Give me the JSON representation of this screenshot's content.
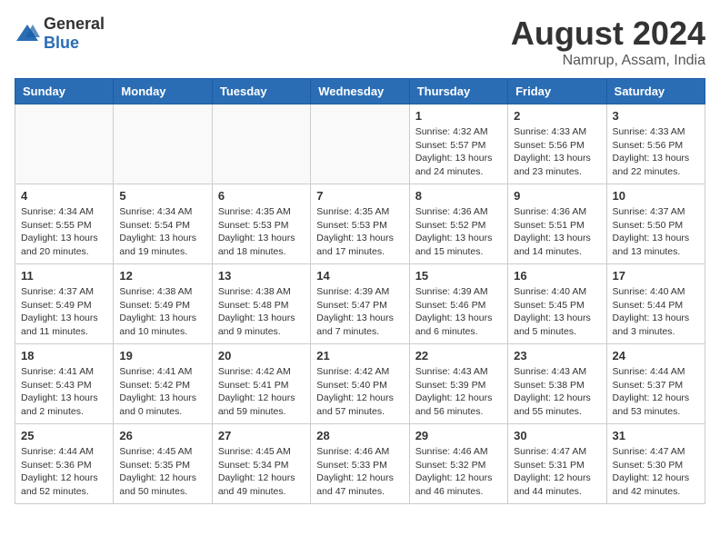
{
  "header": {
    "logo_general": "General",
    "logo_blue": "Blue",
    "month_year": "August 2024",
    "location": "Namrup, Assam, India"
  },
  "days_of_week": [
    "Sunday",
    "Monday",
    "Tuesday",
    "Wednesday",
    "Thursday",
    "Friday",
    "Saturday"
  ],
  "weeks": [
    [
      {
        "day": "",
        "info": ""
      },
      {
        "day": "",
        "info": ""
      },
      {
        "day": "",
        "info": ""
      },
      {
        "day": "",
        "info": ""
      },
      {
        "day": "1",
        "info": "Sunrise: 4:32 AM\nSunset: 5:57 PM\nDaylight: 13 hours\nand 24 minutes."
      },
      {
        "day": "2",
        "info": "Sunrise: 4:33 AM\nSunset: 5:56 PM\nDaylight: 13 hours\nand 23 minutes."
      },
      {
        "day": "3",
        "info": "Sunrise: 4:33 AM\nSunset: 5:56 PM\nDaylight: 13 hours\nand 22 minutes."
      }
    ],
    [
      {
        "day": "4",
        "info": "Sunrise: 4:34 AM\nSunset: 5:55 PM\nDaylight: 13 hours\nand 20 minutes."
      },
      {
        "day": "5",
        "info": "Sunrise: 4:34 AM\nSunset: 5:54 PM\nDaylight: 13 hours\nand 19 minutes."
      },
      {
        "day": "6",
        "info": "Sunrise: 4:35 AM\nSunset: 5:53 PM\nDaylight: 13 hours\nand 18 minutes."
      },
      {
        "day": "7",
        "info": "Sunrise: 4:35 AM\nSunset: 5:53 PM\nDaylight: 13 hours\nand 17 minutes."
      },
      {
        "day": "8",
        "info": "Sunrise: 4:36 AM\nSunset: 5:52 PM\nDaylight: 13 hours\nand 15 minutes."
      },
      {
        "day": "9",
        "info": "Sunrise: 4:36 AM\nSunset: 5:51 PM\nDaylight: 13 hours\nand 14 minutes."
      },
      {
        "day": "10",
        "info": "Sunrise: 4:37 AM\nSunset: 5:50 PM\nDaylight: 13 hours\nand 13 minutes."
      }
    ],
    [
      {
        "day": "11",
        "info": "Sunrise: 4:37 AM\nSunset: 5:49 PM\nDaylight: 13 hours\nand 11 minutes."
      },
      {
        "day": "12",
        "info": "Sunrise: 4:38 AM\nSunset: 5:49 PM\nDaylight: 13 hours\nand 10 minutes."
      },
      {
        "day": "13",
        "info": "Sunrise: 4:38 AM\nSunset: 5:48 PM\nDaylight: 13 hours\nand 9 minutes."
      },
      {
        "day": "14",
        "info": "Sunrise: 4:39 AM\nSunset: 5:47 PM\nDaylight: 13 hours\nand 7 minutes."
      },
      {
        "day": "15",
        "info": "Sunrise: 4:39 AM\nSunset: 5:46 PM\nDaylight: 13 hours\nand 6 minutes."
      },
      {
        "day": "16",
        "info": "Sunrise: 4:40 AM\nSunset: 5:45 PM\nDaylight: 13 hours\nand 5 minutes."
      },
      {
        "day": "17",
        "info": "Sunrise: 4:40 AM\nSunset: 5:44 PM\nDaylight: 13 hours\nand 3 minutes."
      }
    ],
    [
      {
        "day": "18",
        "info": "Sunrise: 4:41 AM\nSunset: 5:43 PM\nDaylight: 13 hours\nand 2 minutes."
      },
      {
        "day": "19",
        "info": "Sunrise: 4:41 AM\nSunset: 5:42 PM\nDaylight: 13 hours\nand 0 minutes."
      },
      {
        "day": "20",
        "info": "Sunrise: 4:42 AM\nSunset: 5:41 PM\nDaylight: 12 hours\nand 59 minutes."
      },
      {
        "day": "21",
        "info": "Sunrise: 4:42 AM\nSunset: 5:40 PM\nDaylight: 12 hours\nand 57 minutes."
      },
      {
        "day": "22",
        "info": "Sunrise: 4:43 AM\nSunset: 5:39 PM\nDaylight: 12 hours\nand 56 minutes."
      },
      {
        "day": "23",
        "info": "Sunrise: 4:43 AM\nSunset: 5:38 PM\nDaylight: 12 hours\nand 55 minutes."
      },
      {
        "day": "24",
        "info": "Sunrise: 4:44 AM\nSunset: 5:37 PM\nDaylight: 12 hours\nand 53 minutes."
      }
    ],
    [
      {
        "day": "25",
        "info": "Sunrise: 4:44 AM\nSunset: 5:36 PM\nDaylight: 12 hours\nand 52 minutes."
      },
      {
        "day": "26",
        "info": "Sunrise: 4:45 AM\nSunset: 5:35 PM\nDaylight: 12 hours\nand 50 minutes."
      },
      {
        "day": "27",
        "info": "Sunrise: 4:45 AM\nSunset: 5:34 PM\nDaylight: 12 hours\nand 49 minutes."
      },
      {
        "day": "28",
        "info": "Sunrise: 4:46 AM\nSunset: 5:33 PM\nDaylight: 12 hours\nand 47 minutes."
      },
      {
        "day": "29",
        "info": "Sunrise: 4:46 AM\nSunset: 5:32 PM\nDaylight: 12 hours\nand 46 minutes."
      },
      {
        "day": "30",
        "info": "Sunrise: 4:47 AM\nSunset: 5:31 PM\nDaylight: 12 hours\nand 44 minutes."
      },
      {
        "day": "31",
        "info": "Sunrise: 4:47 AM\nSunset: 5:30 PM\nDaylight: 12 hours\nand 42 minutes."
      }
    ]
  ]
}
